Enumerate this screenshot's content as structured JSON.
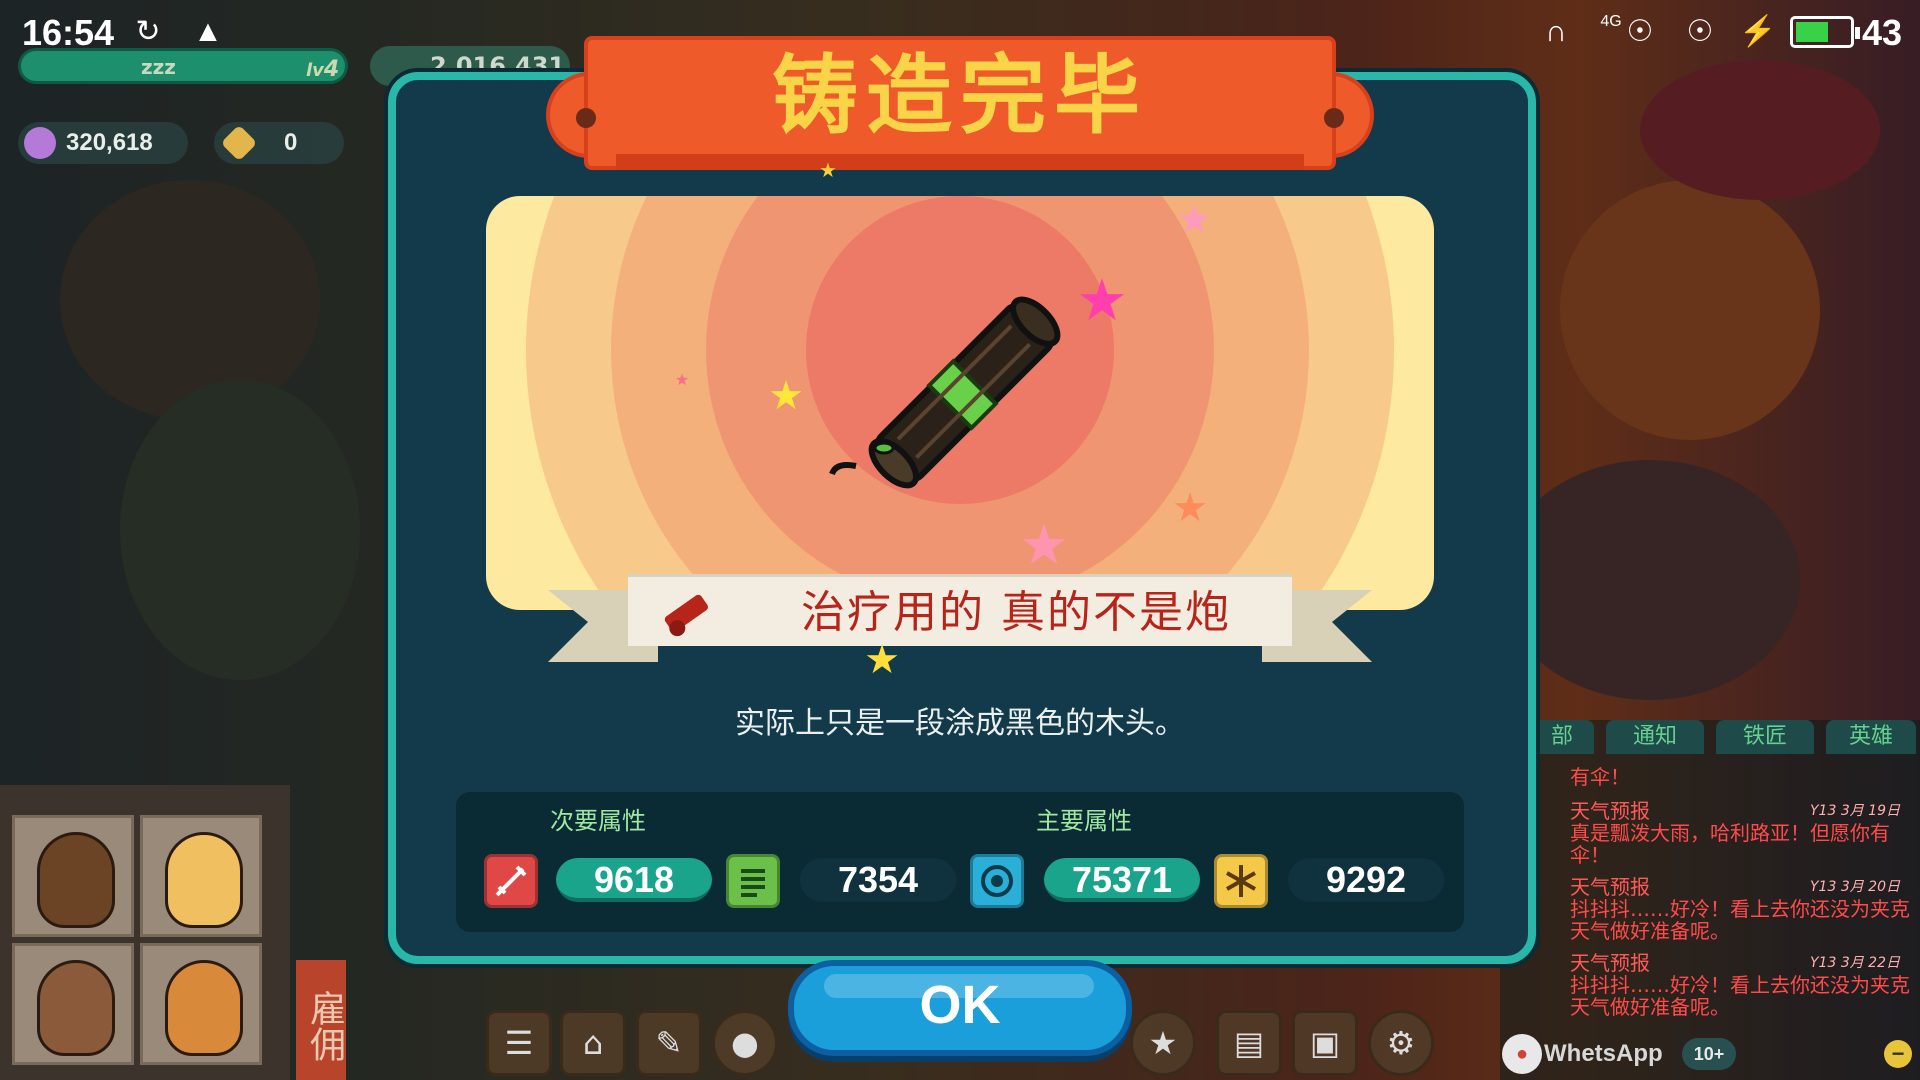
{
  "status_bar": {
    "time": "16:54",
    "battery_level": "43",
    "network": "4G"
  },
  "hud": {
    "level_text": "zzz",
    "level_number": "4",
    "money": "2,016,431",
    "gems": "320,618",
    "tags": "0"
  },
  "dialog": {
    "title": "铸造完毕",
    "item_name": "治疗用的 真的不是炮",
    "description": "实际上只是一段涂成黑色的木头。",
    "secondary_label": "次要属性",
    "primary_label": "主要属性",
    "stats": [
      {
        "icon": "sword-icon",
        "value": "9618",
        "color": "#e04848"
      },
      {
        "icon": "list-icon",
        "value": "7354",
        "color": "#6ac048"
      },
      {
        "icon": "target-icon",
        "value": "75371",
        "color": "#2ab0d8"
      },
      {
        "icon": "snowflake-icon",
        "value": "9292",
        "color": "#f4c848"
      }
    ],
    "ok_label": "OK"
  },
  "side": {
    "hire_label": "雇佣"
  },
  "chat": {
    "tabs": [
      "部",
      "通知",
      "铁匠",
      "英雄"
    ],
    "messages": [
      {
        "head": "",
        "body": "有伞！",
        "date": ""
      },
      {
        "head": "天气预报",
        "body": "真是瓢泼大雨，哈利路亚！但愿你有伞！",
        "date": "Y13 3月 19日"
      },
      {
        "head": "天气预报",
        "body": "抖抖抖……好冷！看上去你还没为夹克天气做好准备呢。",
        "date": "Y13 3月 20日"
      },
      {
        "head": "天气预报",
        "body": "抖抖抖……好冷！看上去你还没为夹克天气做好准备呢。",
        "date": "Y13 3月 22日"
      }
    ]
  },
  "notification": {
    "app": "WhetsApp",
    "count": "10+"
  },
  "colors": {
    "dialog_bg": "#133a4a",
    "dialog_border": "#28b7a8",
    "title_ribbon": "#ef5a2a",
    "title_text": "#f9d448",
    "item_name": "#b7251a",
    "ok_button": "#1a9fdb"
  }
}
